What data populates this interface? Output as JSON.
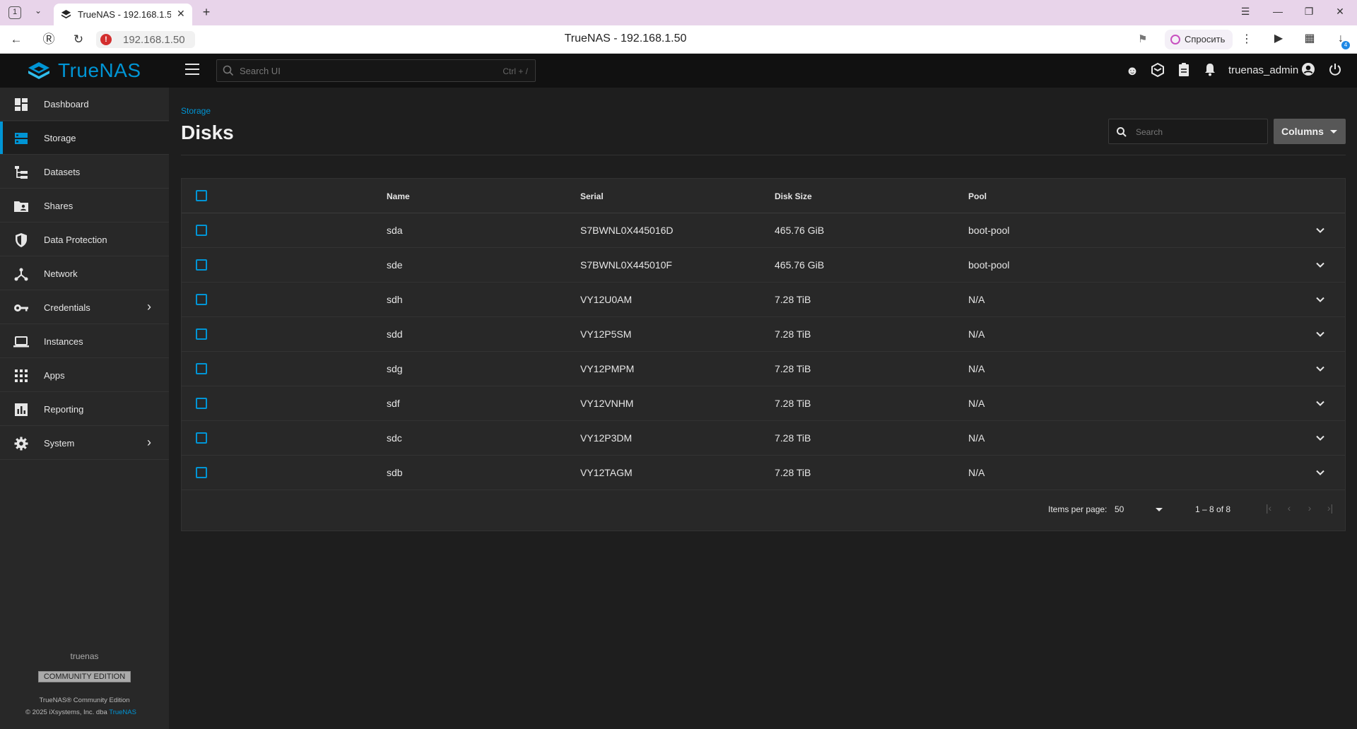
{
  "browser": {
    "tab_counter": "1",
    "tab_title": "TrueNAS - 192.168.1.50",
    "url": "192.168.1.50",
    "page_title": "TrueNAS - 192.168.1.50",
    "ask_label": "Спросить",
    "downloads_badge": "4"
  },
  "app": {
    "brand": "TrueNAS",
    "search_placeholder": "Search UI",
    "search_shortcut": "Ctrl + /",
    "username": "truenas_admin"
  },
  "sidebar": {
    "items": [
      {
        "label": "Dashboard",
        "icon": "dashboard-icon",
        "active": false,
        "chevron": false
      },
      {
        "label": "Storage",
        "icon": "storage-icon",
        "active": true,
        "chevron": false
      },
      {
        "label": "Datasets",
        "icon": "datasets-icon",
        "active": false,
        "chevron": false
      },
      {
        "label": "Shares",
        "icon": "shares-icon",
        "active": false,
        "chevron": false
      },
      {
        "label": "Data Protection",
        "icon": "shield-icon",
        "active": false,
        "chevron": false
      },
      {
        "label": "Network",
        "icon": "network-icon",
        "active": false,
        "chevron": false
      },
      {
        "label": "Credentials",
        "icon": "key-icon",
        "active": false,
        "chevron": true
      },
      {
        "label": "Instances",
        "icon": "laptop-icon",
        "active": false,
        "chevron": false
      },
      {
        "label": "Apps",
        "icon": "apps-grid-icon",
        "active": false,
        "chevron": false
      },
      {
        "label": "Reporting",
        "icon": "bar-chart-icon",
        "active": false,
        "chevron": false
      },
      {
        "label": "System",
        "icon": "gear-icon",
        "active": false,
        "chevron": true
      }
    ],
    "hostname": "truenas",
    "edition": "COMMUNITY EDITION",
    "footer_line1": "TrueNAS® Community Edition",
    "footer_line2": "© 2025 iXsystems, Inc. dba ",
    "footer_link": "TrueNAS"
  },
  "main": {
    "breadcrumb": "Storage",
    "title": "Disks",
    "search_placeholder": "Search",
    "columns_button": "Columns"
  },
  "table": {
    "headers": {
      "name": "Name",
      "serial": "Serial",
      "size": "Disk Size",
      "pool": "Pool"
    },
    "rows": [
      {
        "name": "sda",
        "serial": "S7BWNL0X445016D",
        "size": "465.76 GiB",
        "pool": "boot-pool"
      },
      {
        "name": "sde",
        "serial": "S7BWNL0X445010F",
        "size": "465.76 GiB",
        "pool": "boot-pool"
      },
      {
        "name": "sdh",
        "serial": "VY12U0AM",
        "size": "7.28 TiB",
        "pool": "N/A"
      },
      {
        "name": "sdd",
        "serial": "VY12P5SM",
        "size": "7.28 TiB",
        "pool": "N/A"
      },
      {
        "name": "sdg",
        "serial": "VY12PMPM",
        "size": "7.28 TiB",
        "pool": "N/A"
      },
      {
        "name": "sdf",
        "serial": "VY12VNHM",
        "size": "7.28 TiB",
        "pool": "N/A"
      },
      {
        "name": "sdc",
        "serial": "VY12P3DM",
        "size": "7.28 TiB",
        "pool": "N/A"
      },
      {
        "name": "sdb",
        "serial": "VY12TAGM",
        "size": "7.28 TiB",
        "pool": "N/A"
      }
    ],
    "pager": {
      "items_label": "Items per page:",
      "page_size": "50",
      "range": "1 – 8 of 8"
    }
  },
  "colors": {
    "accent": "#0095d5",
    "header_bg": "#111111",
    "sidebar_bg": "#282828",
    "content_bg": "#1e1e1e"
  }
}
